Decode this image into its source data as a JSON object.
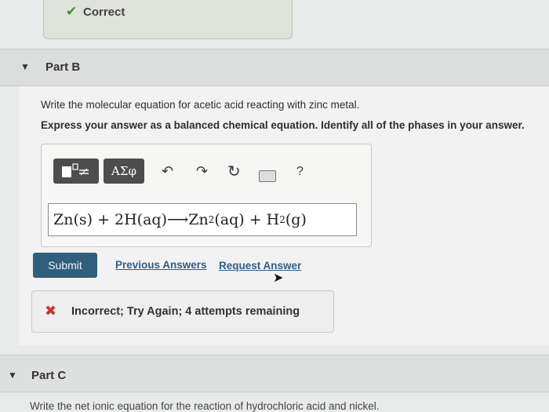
{
  "feedback_correct": {
    "label": "Correct",
    "icon": "check-icon"
  },
  "part_b": {
    "title": "Part B",
    "question": "Write the molecular equation for acetic acid reacting with zinc metal.",
    "instruction": "Express your answer as a balanced chemical equation. Identify all of the phases in your answer.",
    "toolbar": {
      "greek_label": "ΑΣφ",
      "help_label": "?"
    },
    "answer": {
      "t1": "Zn(s) + 2H(aq)",
      "arrow": "⟶",
      "t2": "Zn",
      "s1": "2",
      "t3": "(aq) + H",
      "s2": "2",
      "t4": "(g)"
    },
    "submit_label": "Submit",
    "previous_answers_label": "Previous Answers",
    "request_answer_label": "Request Answer",
    "feedback_incorrect": {
      "icon": "x-icon",
      "message": "Incorrect; Try Again; 4 attempts remaining"
    }
  },
  "part_c": {
    "title": "Part C",
    "question_partial": "Write the net ionic equation for the reaction of hydrochloric acid and nickel."
  },
  "colors": {
    "submit_bg": "#2f5f7a",
    "link": "#2f5f8a",
    "correct_check": "#3f8f2d",
    "incorrect_x": "#c0392b"
  }
}
